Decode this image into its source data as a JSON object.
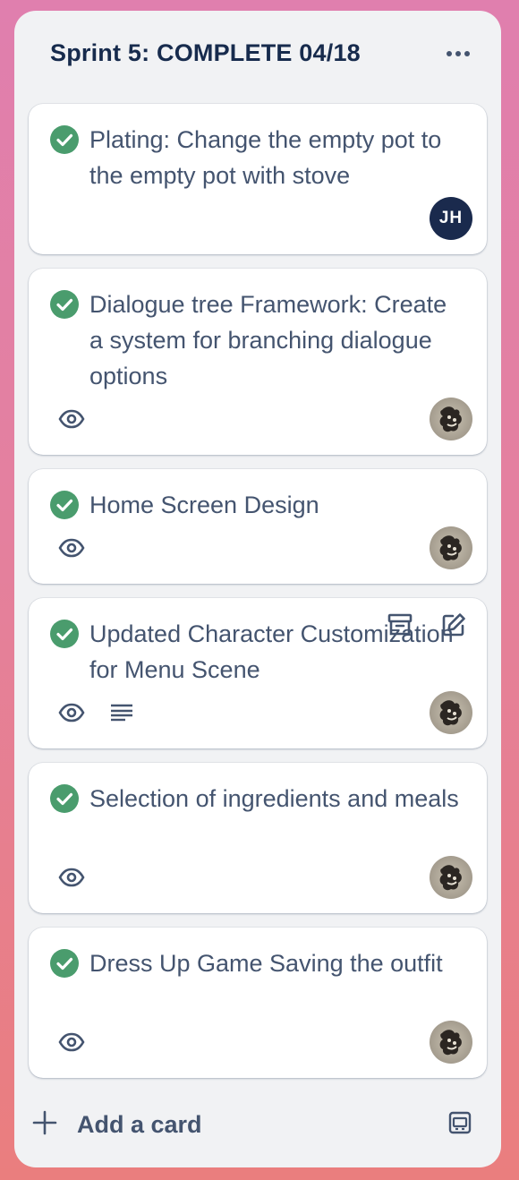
{
  "list": {
    "title": "Sprint 5: COMPLETE 04/18",
    "menu_icon": "more-horizontal-icon",
    "add_card_label": "Add a card",
    "template_icon": "card-template-icon"
  },
  "colors": {
    "background_top": "#e07fae",
    "background_bottom": "#ea7e7e",
    "list_bg": "#f1f2f4",
    "check_green": "#4a9c6d",
    "text": "#44546f",
    "title": "#172b4d",
    "avatar_jh": "#1a2a4d"
  },
  "cards": [
    {
      "title": "Plating: Change the empty pot to the empty pot with stove",
      "status_icon": "check-circle-icon",
      "watching": false,
      "avatar": "JH"
    },
    {
      "title": "Dialogue tree Framework: Create a system for branching dialogue options",
      "status_icon": "check-circle-icon",
      "watching": true,
      "avatar": "photo"
    },
    {
      "title": "Home Screen Design",
      "status_icon": "check-circle-icon",
      "watching": true,
      "avatar": "photo"
    },
    {
      "title": "Updated Character Customization for Menu Scene",
      "status_icon": "check-circle-icon",
      "watching": true,
      "has_description": true,
      "avatar": "photo",
      "hover_actions": [
        "archive-icon",
        "edit-icon"
      ]
    },
    {
      "title": "Selection of ingredients and meals",
      "status_icon": "check-circle-icon",
      "watching": true,
      "avatar": "photo"
    },
    {
      "title": "Dress Up Game Saving the outfit",
      "status_icon": "check-circle-icon",
      "watching": true,
      "avatar": "photo"
    }
  ]
}
